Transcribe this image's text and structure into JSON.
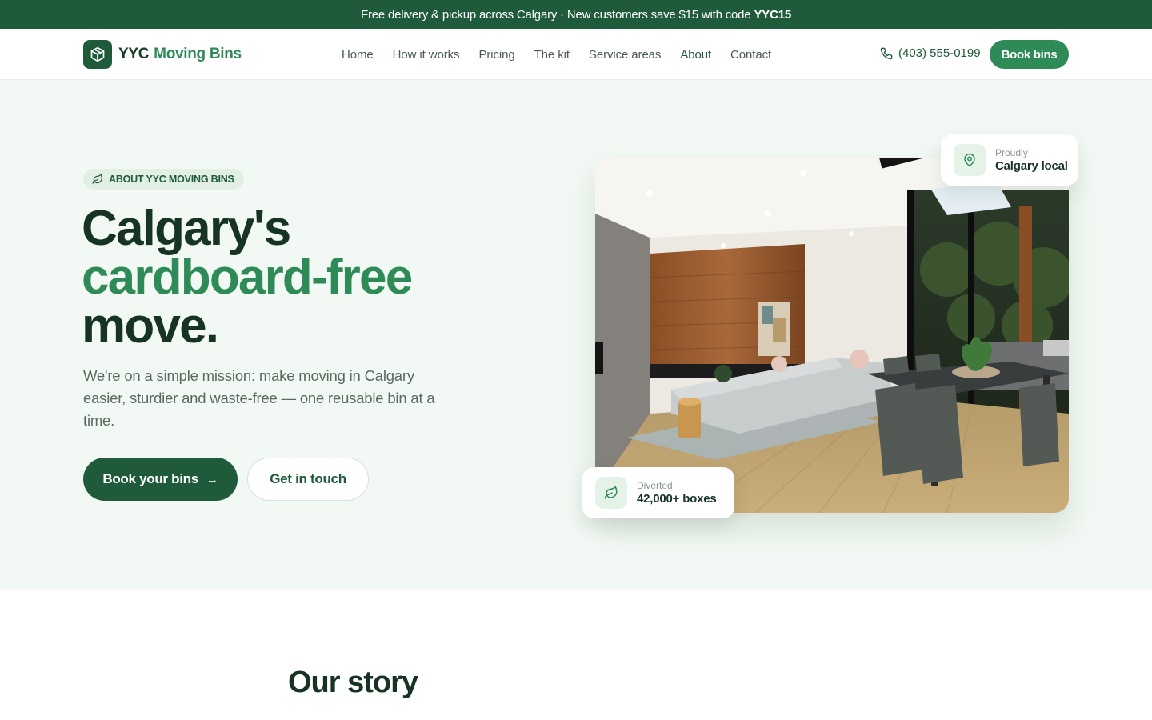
{
  "promo": {
    "text": "Free delivery & pickup across Calgary · New customers save $15 with code",
    "code": "YYC15"
  },
  "nav": {
    "logo_part1": "YYC",
    "logo_part2": "Moving Bins",
    "links": [
      "Home",
      "How it works",
      "Pricing",
      "The kit",
      "Service areas",
      "About",
      "Contact"
    ],
    "active_link": "About",
    "phone": "(403) 555-0199",
    "book_label": "Book bins"
  },
  "hero": {
    "eyebrow": "ABOUT YYC MOVING BINS",
    "title_line1": "Calgary's",
    "title_line2": "cardboard-free",
    "title_line3": "move.",
    "lead": "We're on a simple mission: make moving in Calgary easier, sturdier and waste-free — one reusable bin at a time.",
    "cta_primary": "Book your bins",
    "cta_primary_arrow": "→",
    "cta_secondary": "Get in touch",
    "badge_top_small": "Proudly",
    "badge_top_big": "Calgary local",
    "badge_bottom_small": "Diverted",
    "badge_bottom_big": "42,000+ boxes"
  },
  "story": {
    "title": "Our story"
  },
  "colors": {
    "brand_dark": "#1f5b3a",
    "brand": "#2e8b57",
    "hero_bg": "#f2f8f3"
  },
  "icons": {
    "logo": "box-icon",
    "phone": "phone-icon",
    "eyebrow": "leaf-icon",
    "location": "map-pin-icon",
    "recycle": "leaf-icon"
  }
}
